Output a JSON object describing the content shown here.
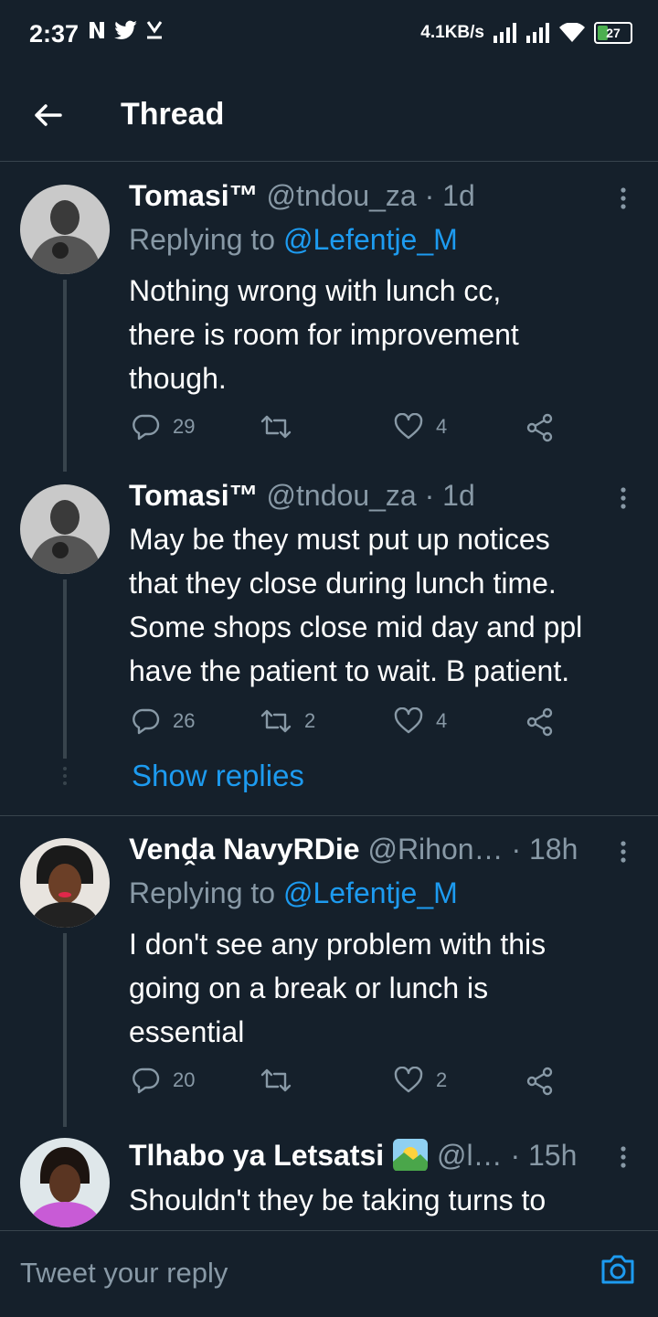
{
  "status_bar": {
    "time": "2:37",
    "net_speed": "4.1KB/s",
    "battery": "27"
  },
  "header": {
    "title": "Thread"
  },
  "tweets": [
    {
      "name": "Tomasi™",
      "handle": "@tndou_za",
      "time": "· 1d",
      "replying_prefix": "Replying to ",
      "replying_to": "@Lefentje_M",
      "lines": [
        "Nothing wrong with lunch cc,",
        "there is room for improvement",
        "though."
      ],
      "replies": "29",
      "retweets": "",
      "likes": "4"
    },
    {
      "name": "Tomasi™",
      "handle": "@tndou_za",
      "time": "· 1d",
      "lines": [
        "May be they must put up notices",
        "that they close during lunch time.",
        "Some shops close mid day and ppl",
        "have the patient to wait. B patient."
      ],
      "replies": "26",
      "retweets": "2",
      "likes": "4"
    },
    {
      "name": "Venḓa NavyRDie",
      "handle": "@Rihon…",
      "time": "· 18h",
      "replying_prefix": "Replying to ",
      "replying_to": "@Lefentje_M",
      "lines": [
        "I don't see any problem with this",
        "going on a break or lunch is",
        "essential"
      ],
      "replies": "20",
      "retweets": "",
      "likes": "2"
    },
    {
      "name": "Tlhabo ya Letsatsi",
      "handle": "@l…",
      "time": "· 15h",
      "lines": [
        "Shouldn't they be taking turns to"
      ]
    }
  ],
  "show_replies": "Show replies",
  "reply_bar": {
    "placeholder": "Tweet your reply"
  },
  "icons": [
    "back-arrow-icon",
    "more-vertical-icon",
    "reply-icon",
    "retweet-icon",
    "like-icon",
    "share-icon",
    "camera-icon",
    "sunrise-emoji-icon"
  ],
  "colors": {
    "background": "#15202b",
    "accent": "#1d9bf0",
    "muted": "#8899a6",
    "divider": "#38444d"
  }
}
